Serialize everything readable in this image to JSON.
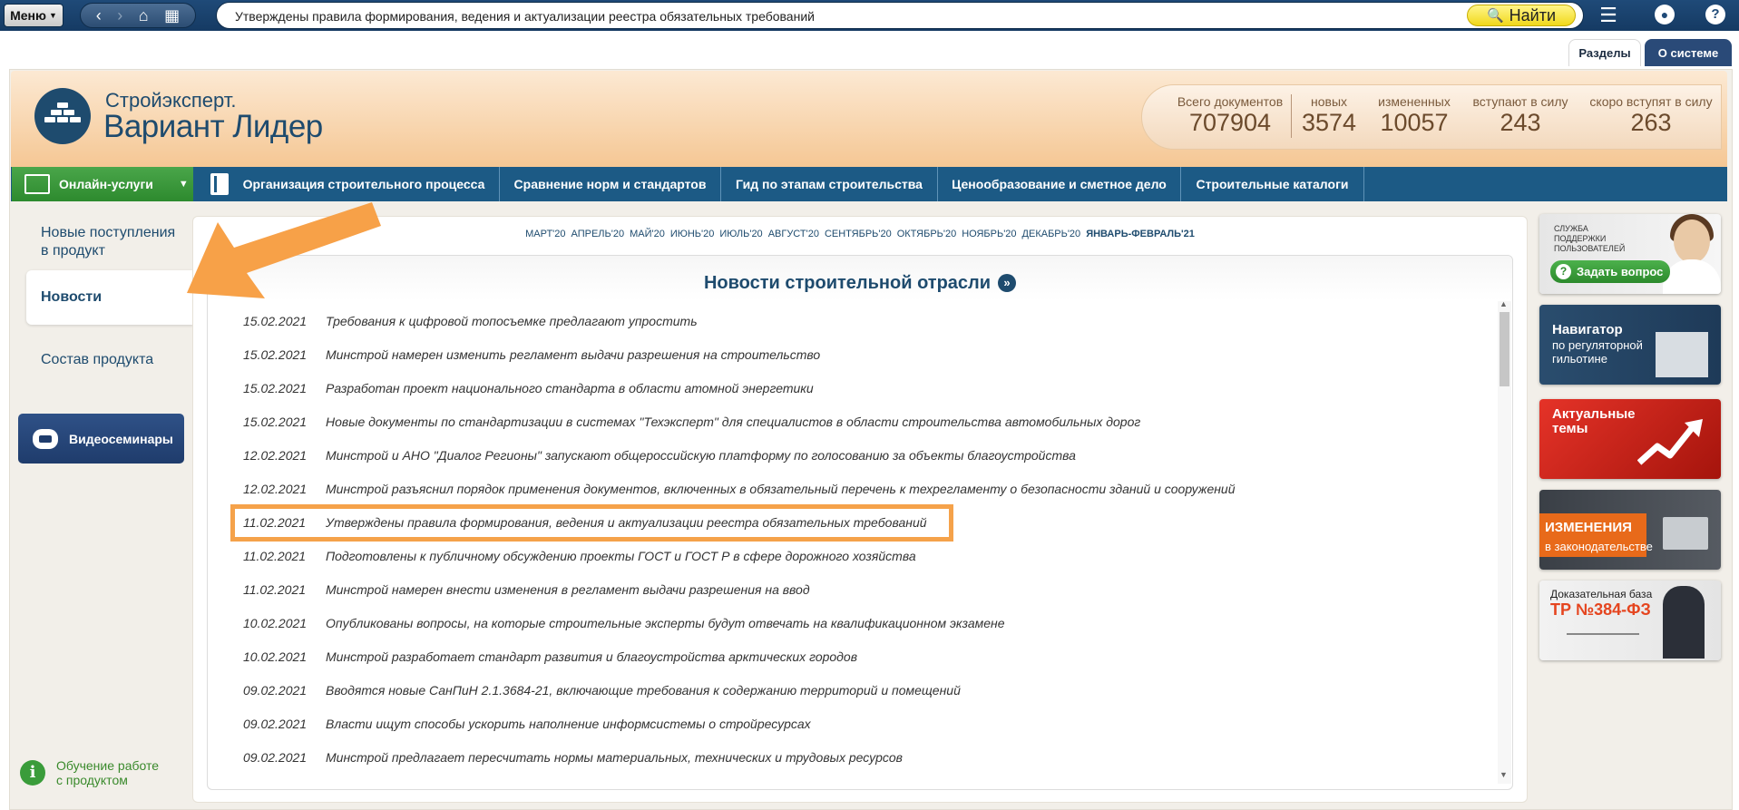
{
  "toolbar": {
    "menu_label": "Меню",
    "address_text": "Утверждены правила формирования, ведения и актуализации реестра обязательных требований",
    "find_label": "Найти"
  },
  "upper_tabs": [
    {
      "label": "Разделы",
      "active": true
    },
    {
      "label": "О системе",
      "active": false
    }
  ],
  "logo": {
    "line1": "Стройэксперт.",
    "line2": "Вариант Лидер"
  },
  "stats": [
    {
      "label": "Всего документов",
      "value": "707904"
    },
    {
      "label": "новых",
      "value": "3574"
    },
    {
      "label": "измененных",
      "value": "10057"
    },
    {
      "label": "вступают в силу",
      "value": "243"
    },
    {
      "label": "скоро вступят в силу",
      "value": "263"
    }
  ],
  "nav": {
    "online_label": "Онлайн-услуги",
    "items": [
      "Организация строительного процесса",
      "Сравнение норм и стандартов",
      "Гид по этапам строительства",
      "Ценообразование и сметное дело",
      "Строительные каталоги"
    ]
  },
  "sidebar": {
    "items": [
      {
        "label_line1": "Новые поступления",
        "label_line2": "в продукт"
      },
      {
        "label_line1": "Новости",
        "label_line2": "",
        "active": true
      },
      {
        "label_line1": "Состав продукта",
        "label_line2": ""
      }
    ],
    "video_label": "Видеосеминары",
    "learn_line1": "Обучение работе",
    "learn_line2": "с продуктом"
  },
  "months": [
    "МАРТ'20",
    "АПРЕЛЬ'20",
    "МАЙ'20",
    "ИЮНЬ'20",
    "ИЮЛЬ'20",
    "АВГУСТ'20",
    "СЕНТЯБРЬ'20",
    "ОКТЯБРЬ'20",
    "НОЯБРЬ'20",
    "ДЕКАБРЬ'20",
    "ЯНВАРЬ-ФЕВРАЛЬ'21"
  ],
  "current_month": "ЯНВАРЬ-ФЕВРАЛЬ'21",
  "news": {
    "title": "Новости строительной отрасли",
    "highlighted_index": 6,
    "items": [
      {
        "date": "15.02.2021",
        "text": "Требования к цифровой топосъемке предлагают упростить"
      },
      {
        "date": "15.02.2021",
        "text": "Минстрой намерен изменить регламент выдачи разрешения на строительство"
      },
      {
        "date": "15.02.2021",
        "text": "Разработан проект национального стандарта в области атомной энергетики"
      },
      {
        "date": "15.02.2021",
        "text": "Новые документы по стандартизации в системах \"Техэксперт\" для специалистов в области строительства автомобильных дорог"
      },
      {
        "date": "12.02.2021",
        "text": "Минстрой и АНО \"Диалог Регионы\" запускают общероссийскую платформу по голосованию за объекты благоустройства"
      },
      {
        "date": "12.02.2021",
        "text": "Минстрой разъяснил порядок применения документов, включенных в обязательный перечень к техрегламенту о безопасности зданий и сооружений"
      },
      {
        "date": "11.02.2021",
        "text": "Утверждены правила формирования, ведения и актуализации реестра обязательных требований"
      },
      {
        "date": "11.02.2021",
        "text": "Подготовлены к публичному обсуждению проекты ГОСТ и ГОСТ Р в сфере дорожного хозяйства"
      },
      {
        "date": "11.02.2021",
        "text": "Минстрой намерен внести изменения в регламент выдачи разрешения на ввод"
      },
      {
        "date": "10.02.2021",
        "text": "Опубликованы вопросы, на которые строительные эксперты будут отвечать на квалификационном экзамене"
      },
      {
        "date": "10.02.2021",
        "text": "Минстрой разработает стандарт развития и благоустройства арктических городов"
      },
      {
        "date": "09.02.2021",
        "text": "Вводятся новые СанПиН 2.1.3684-21, включающие требования к содержанию территорий и помещений"
      },
      {
        "date": "09.02.2021",
        "text": "Власти ищут способы ускорить наполнение информсистемы о стройресурсах"
      },
      {
        "date": "09.02.2021",
        "text": "Минстрой предлагает пересчитать нормы материальных, технических и трудовых ресурсов"
      }
    ]
  },
  "banners": {
    "support": {
      "line1": "СЛУЖБА",
      "line2": "ПОДДЕРЖКИ",
      "line3": "ПОЛЬЗОВАТЕЛЕЙ",
      "button": "Задать вопрос"
    },
    "navigator": {
      "title": "Навигатор",
      "line1": "по регуляторной",
      "line2": "гильотине"
    },
    "topics": {
      "line1": "Актуальные",
      "line2": "темы"
    },
    "changes": {
      "line1": "ИЗМЕНЕНИЯ",
      "line2": "в законодательстве"
    },
    "evidence": {
      "line1": "Доказательная база",
      "line2": "ТР №384-ФЗ"
    }
  },
  "colors": {
    "toolbar": "#1f4a78",
    "nav_strip": "#1c5a85",
    "online_green": "#2d8a2e",
    "title_blue": "#1e4b6e",
    "highlight_orange": "#f5a24a"
  }
}
